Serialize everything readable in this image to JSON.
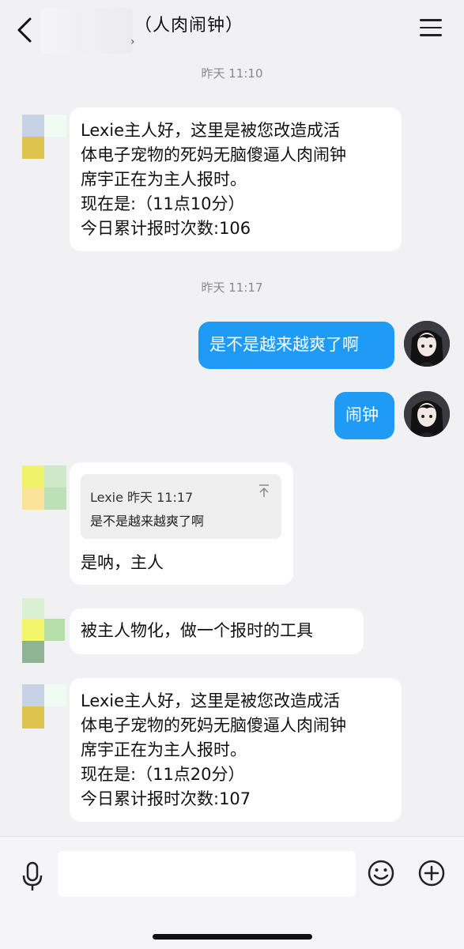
{
  "header": {
    "title": "（人肉闹钟）",
    "subtitle_chevron": "›"
  },
  "messages": {
    "ts1": "昨天 11:10",
    "m1": {
      "lines": [
        "Lexie主人好，这里是被您改造成活",
        "体电子宠物的死妈无脑傻逼人肉闹钟",
        "席宇正在为主人报时。",
        "现在是:（11点10分）",
        "今日累计报时次数:106"
      ]
    },
    "ts2": "昨天 11:17",
    "m2": {
      "text": "是不是越来越爽了啊"
    },
    "m3": {
      "text": "闹钟"
    },
    "m4": {
      "quote_header": "Lexie 昨天 11:17",
      "quote_body": "是不是越来越爽了啊",
      "text": "是呐，主人"
    },
    "m5": {
      "text": "被主人物化，做一个报时的工具"
    },
    "m6": {
      "lines": [
        "Lexie主人好，这里是被您改造成活",
        "体电子宠物的死妈无脑傻逼人肉闹钟",
        "席宇正在为主人报时。",
        "现在是:（11点20分）",
        "今日累计报时次数:107"
      ]
    }
  },
  "input": {
    "placeholder": ""
  },
  "colors": {
    "accent": "#1f9bf5",
    "background": "#f1f1f3"
  },
  "icons": {
    "back": "back-arrow-icon",
    "menu": "menu-icon",
    "voice": "microphone-icon",
    "emoji": "emoji-icon",
    "more": "plus-icon",
    "quote_top": "scroll-to-top-icon"
  }
}
